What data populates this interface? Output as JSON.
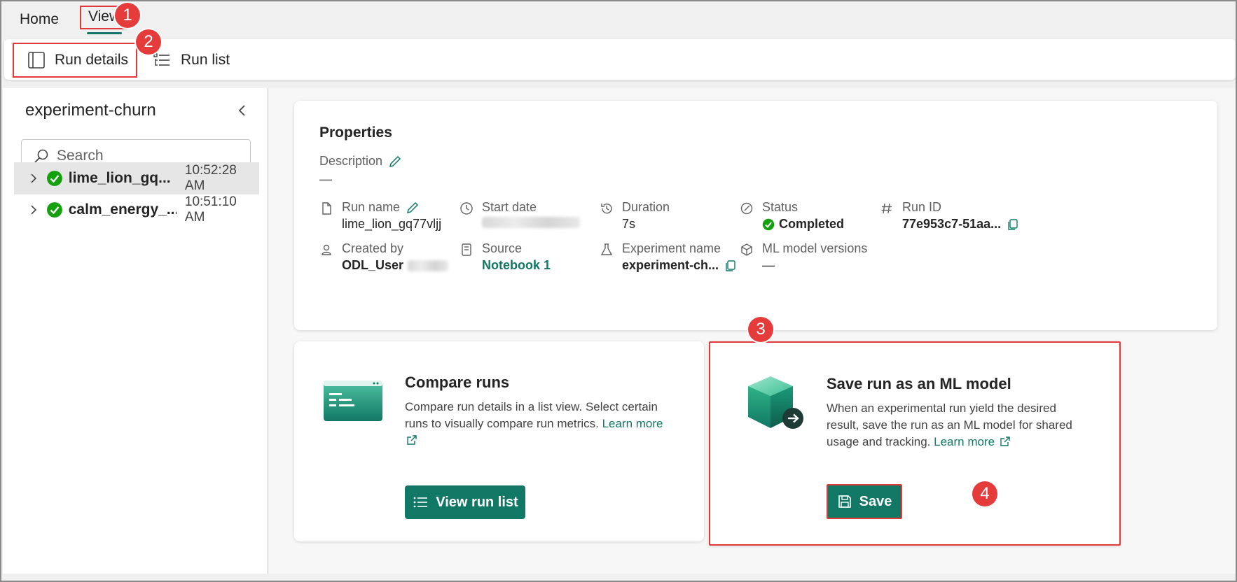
{
  "top_tabs": {
    "home": "Home",
    "view": "View"
  },
  "ribbon": {
    "run_details": "Run details",
    "run_list": "Run list"
  },
  "badges": [
    "1",
    "2",
    "3",
    "4"
  ],
  "left_pane": {
    "title": "experiment-churn",
    "search_placeholder": "Search",
    "runs": [
      {
        "name": "lime_lion_gq...",
        "time": "10:52:28 AM",
        "selected": true
      },
      {
        "name": "calm_energy_...",
        "time": "10:51:10 AM",
        "selected": false
      }
    ]
  },
  "properties": {
    "title": "Properties",
    "description_label": "Description",
    "description_value": "—",
    "run_name_label": "Run name",
    "run_name_value": "lime_lion_gq77vljj",
    "start_date_label": "Start date",
    "duration_label": "Duration",
    "duration_value": "7s",
    "status_label": "Status",
    "status_value": "Completed",
    "run_id_label": "Run ID",
    "run_id_value": "77e953c7-51aa...",
    "created_by_label": "Created by",
    "created_by_value": "ODL_User",
    "source_label": "Source",
    "source_value": "Notebook 1",
    "experiment_name_label": "Experiment name",
    "experiment_name_value": "experiment-ch...",
    "ml_versions_label": "ML model versions",
    "ml_versions_value": "—"
  },
  "compare_card": {
    "title": "Compare runs",
    "text": "Compare run details in a list view. Select certain runs to visually compare run metrics.",
    "learn_more": "Learn more",
    "button": "View run list"
  },
  "save_card": {
    "title": "Save run as an ML model",
    "text": "When an experimental run yield the desired result, save the run as an ML model for shared usage and tracking.",
    "learn_more": "Learn more",
    "button": "Save"
  },
  "colors": {
    "accent": "#117865",
    "highlight": "#e03a3a",
    "success": "#13a10e"
  }
}
